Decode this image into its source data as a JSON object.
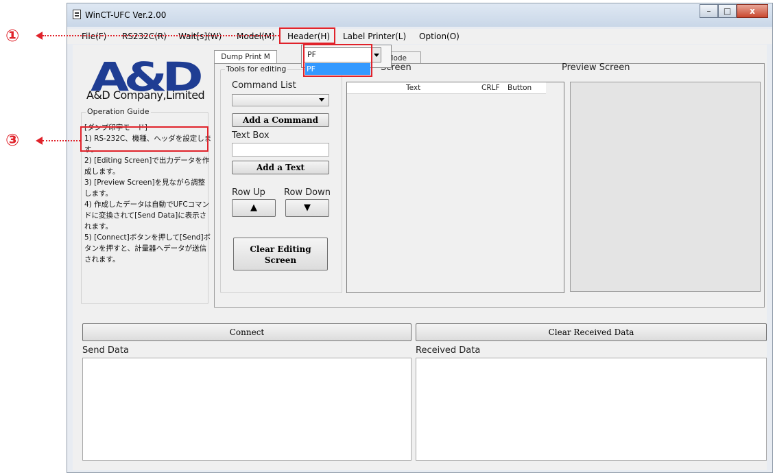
{
  "annotations": {
    "marker_1": "①",
    "marker_3": "③"
  },
  "window": {
    "title": "WinCT-UFC  Ver.2.00",
    "buttons": {
      "minimize": "–",
      "maximize": "□",
      "close": "x"
    }
  },
  "menu": {
    "items": [
      "File(F)",
      "RS232C(R)",
      "Wait[s](W)",
      "Model(M)",
      "Header(H)",
      "Label Printer(L)",
      "Option(O)"
    ]
  },
  "header_dropdown": {
    "selected": "PF",
    "options": [
      "PF"
    ]
  },
  "logo": {
    "brand": "A&D",
    "company": "A&D Company,Limited"
  },
  "operation_guide": {
    "title": "Operation Guide",
    "lines": [
      "[ダンプ印字モード]",
      "1) RS-232C、機種、ヘッダを設定します。",
      "2) [Editing Screen]で出力データを作成します。",
      "3) [Preview Screen]を見ながら調整します。",
      "4) 作成したデータは自動でUFCコマンドに変換されて[Send Data]に表示されます。",
      "5) [Connect]ボタンを押して[Send]ボタンを押すと、計量器へデータが送信されます。"
    ]
  },
  "tabs": {
    "dump_print": "Dump Print M",
    "other": "t Mode"
  },
  "tools": {
    "title": "Tools for editing",
    "command_list_label": "Command List",
    "command_list_value": "",
    "add_command": "Add a Command",
    "text_box_label": "Text Box",
    "text_box_value": "",
    "add_text": "Add a Text",
    "row_up_label": "Row Up",
    "row_down_label": "Row Down",
    "row_up_symbol": "▲",
    "row_down_symbol": "▼",
    "clear_editing_line1": "Clear Editing",
    "clear_editing_line2": "Screen"
  },
  "editing_screen": {
    "title": "Screen",
    "columns": [
      "Text",
      "CRLF",
      "Button"
    ]
  },
  "preview_screen": {
    "title": "Preview Screen"
  },
  "bottom": {
    "connect": "Connect",
    "clear_received": "Clear Received Data",
    "send_data_label": "Send Data",
    "received_data_label": "Received Data"
  }
}
